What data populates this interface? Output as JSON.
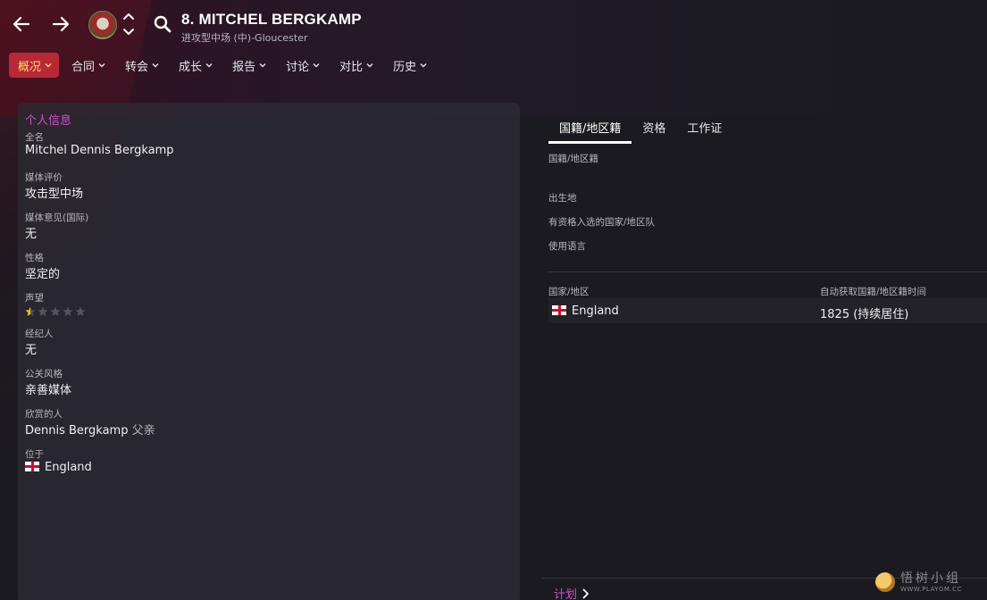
{
  "header": {
    "title": "8. MITCHEL BERGKAMP",
    "subtitle": "进攻型中场 (中)-Gloucester"
  },
  "menu": [
    {
      "label": "概况",
      "active": true
    },
    {
      "label": "合同"
    },
    {
      "label": "转会"
    },
    {
      "label": "成长"
    },
    {
      "label": "报告"
    },
    {
      "label": "讨论"
    },
    {
      "label": "对比"
    },
    {
      "label": "历史"
    }
  ],
  "personal": {
    "section_title": "个人信息",
    "full_name_label": "全名",
    "full_name": "Mitchel Dennis Bergkamp",
    "media_label": "媒体评价",
    "media": "攻击型中场",
    "media_opinion_label": "媒体意见(国际)",
    "media_opinion": "无",
    "personality_label": "性格",
    "personality": "坚定的",
    "reputation_label": "声望",
    "reputation_stars": 0.5,
    "agent_label": "经纪人",
    "agent": "无",
    "pr_label": "公关风格",
    "pr": "亲善媒体",
    "admired_label": "欣赏的人",
    "admired_name": "Dennis Bergkamp",
    "admired_relation": "父亲",
    "location_label": "位于",
    "location": "England"
  },
  "tabs": [
    "国籍/地区籍",
    "资格",
    "工作证"
  ],
  "nationality": {
    "nationality_label": "国籍/地区籍",
    "birthplace_label": "出生地",
    "eligible_label": "有资格入选的国家/地区队",
    "language_label": "使用语言",
    "col_country": "国家/地区",
    "col_acquired": "自动获取国籍/地区籍时间",
    "row_country": "England",
    "row_acquired": "1825 (持续居住)"
  },
  "footer": {
    "plan_label": "计划"
  },
  "watermark": {
    "cn": "悟树小组",
    "en": "WWW.PLAYGM.CC"
  },
  "colors": {
    "accent": "#d14fc8",
    "active_menu_bg": "#b82838",
    "active_menu_text": "#ffd86a"
  }
}
